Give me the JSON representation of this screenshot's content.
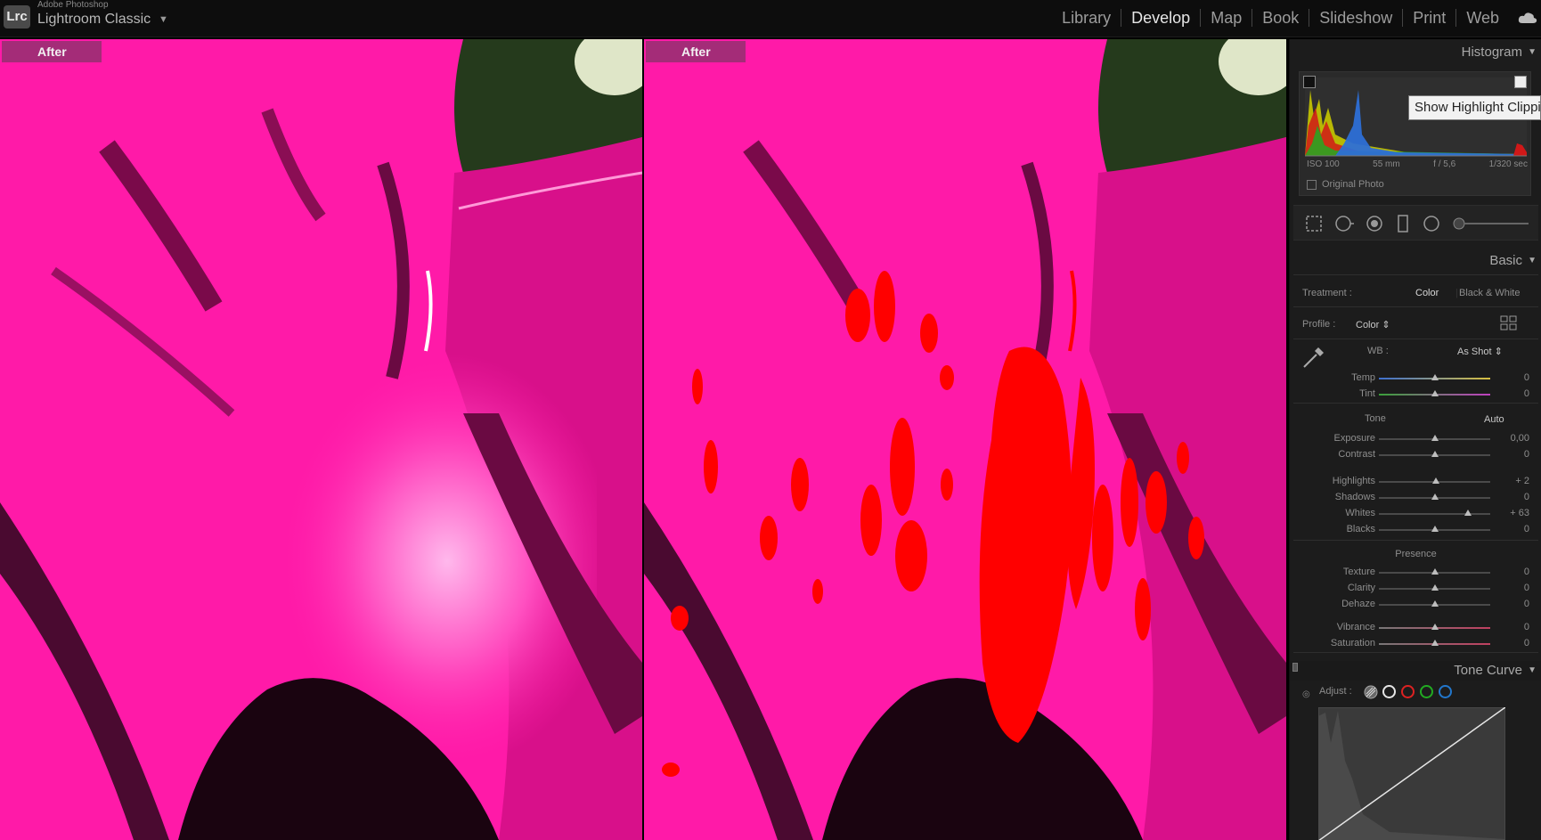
{
  "app": {
    "vendor": "Adobe Photoshop",
    "name": "Lightroom Classic",
    "logo": "Lrc"
  },
  "modules": [
    "Library",
    "Develop",
    "Map",
    "Book",
    "Slideshow",
    "Print",
    "Web"
  ],
  "active_module": "Develop",
  "views": {
    "left_label": "After",
    "right_label": "After"
  },
  "histogram": {
    "title": "Histogram",
    "iso": "ISO 100",
    "focal": "55 mm",
    "aperture": "f / 5,6",
    "shutter": "1/320 sec",
    "original_photo": "Original Photo",
    "tooltip": "Show Highlight Clipping"
  },
  "basic": {
    "title": "Basic",
    "treatment_label": "Treatment :",
    "treatment_color": "Color",
    "treatment_bw": "Black & White",
    "profile_label": "Profile :",
    "profile_value": "Color",
    "wb_label": "WB :",
    "wb_value": "As Shot",
    "tone_label": "Tone",
    "auto_label": "Auto",
    "presence_label": "Presence",
    "sliders": [
      {
        "label": "Temp",
        "value": "0",
        "pos": 0.5
      },
      {
        "label": "Tint",
        "value": "0",
        "pos": 0.5
      },
      {
        "label": "Exposure",
        "value": "0,00",
        "pos": 0.5
      },
      {
        "label": "Contrast",
        "value": "0",
        "pos": 0.5
      },
      {
        "label": "Highlights",
        "value": "+ 2",
        "pos": 0.51
      },
      {
        "label": "Shadows",
        "value": "0",
        "pos": 0.5
      },
      {
        "label": "Whites",
        "value": "+ 63",
        "pos": 0.8
      },
      {
        "label": "Blacks",
        "value": "0",
        "pos": 0.5
      },
      {
        "label": "Texture",
        "value": "0",
        "pos": 0.5
      },
      {
        "label": "Clarity",
        "value": "0",
        "pos": 0.5
      },
      {
        "label": "Dehaze",
        "value": "0",
        "pos": 0.5
      },
      {
        "label": "Vibrance",
        "value": "0",
        "pos": 0.5
      },
      {
        "label": "Saturation",
        "value": "0",
        "pos": 0.5
      }
    ]
  },
  "tone_curve": {
    "title": "Tone Curve",
    "adjust_label": "Adjust :"
  },
  "colors": {
    "petal": "#ff1aa8",
    "clipping": "#ff0000",
    "panel": "#1c1c1c"
  }
}
